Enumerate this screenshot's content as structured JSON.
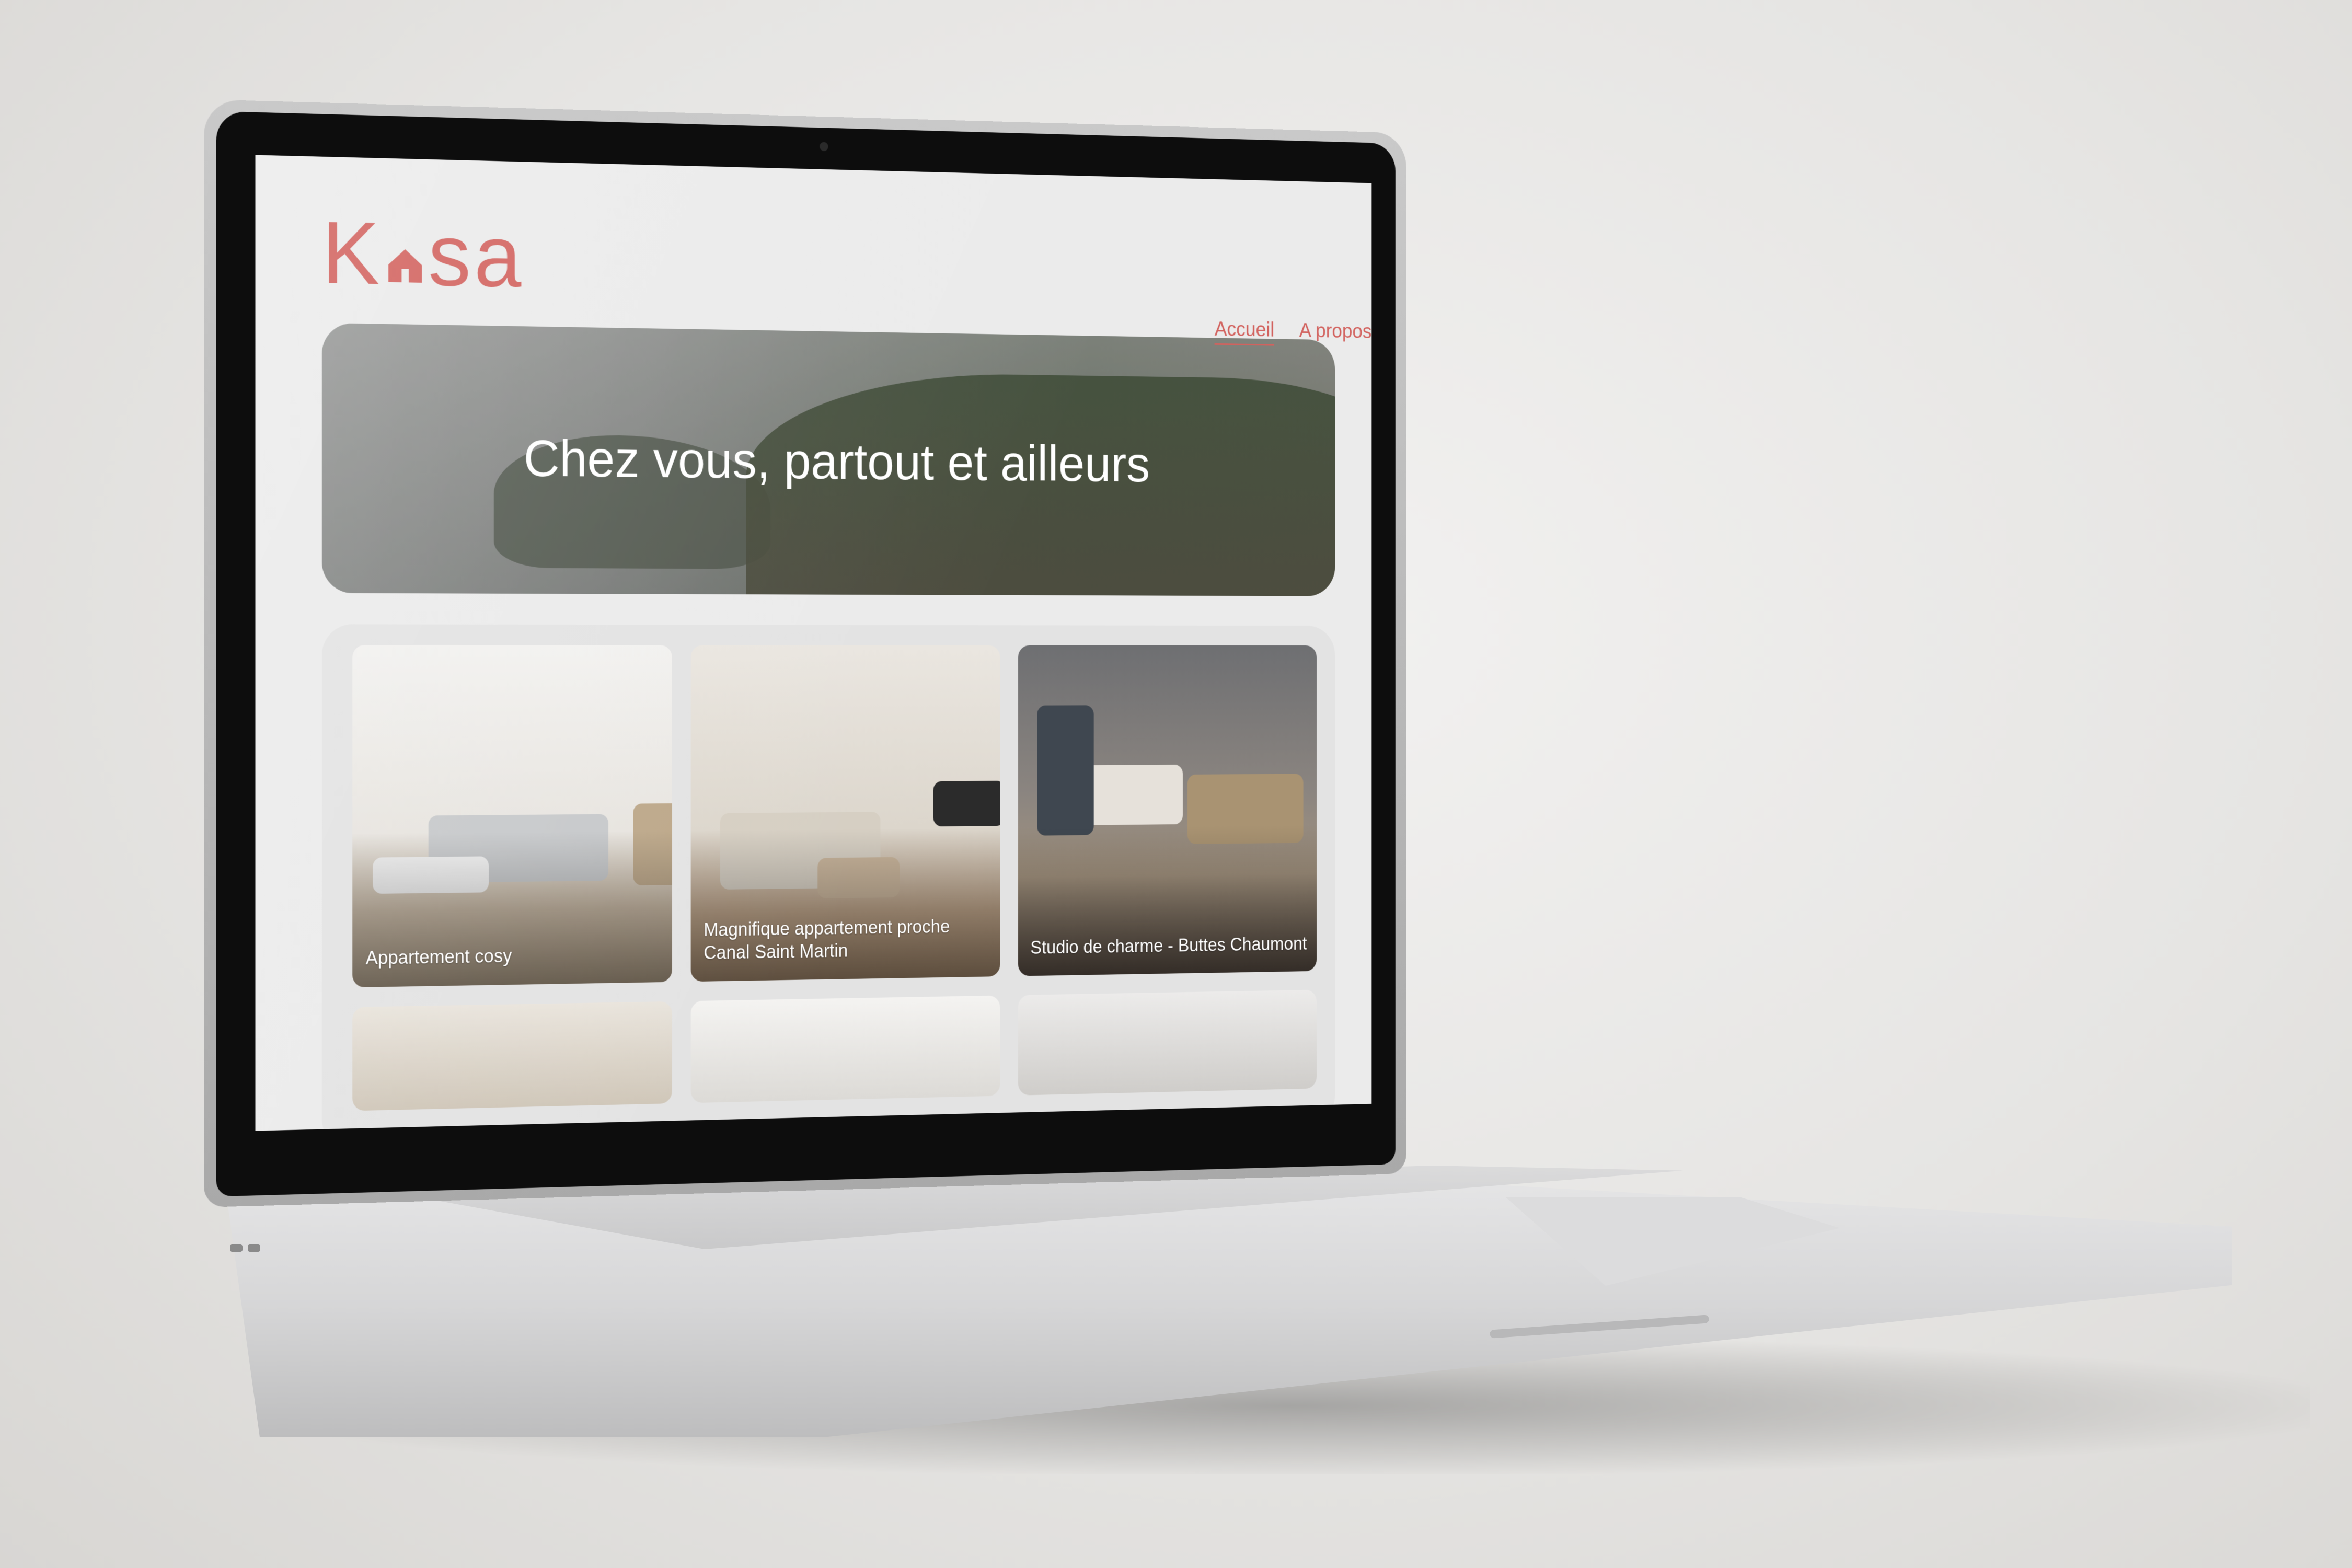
{
  "site": {
    "logo": {
      "text_before": "K",
      "text_after": "sa",
      "icon": "house-icon",
      "color": "#d2625e"
    },
    "nav": [
      {
        "label": "Accueil",
        "active": true
      },
      {
        "label": "A propos",
        "active": false
      }
    ],
    "banner": {
      "title": "Chez vous, partout et ailleurs"
    },
    "listings": [
      {
        "title": "Appartement cosy"
      },
      {
        "title": "Magnifique appartement proche Canal Saint Martin"
      },
      {
        "title": "Studio de charme - Buttes Chaumont"
      },
      {
        "title": ""
      },
      {
        "title": ""
      },
      {
        "title": ""
      }
    ]
  },
  "colors": {
    "accent": "#d2625e",
    "screen_bg": "#ebebeb"
  }
}
